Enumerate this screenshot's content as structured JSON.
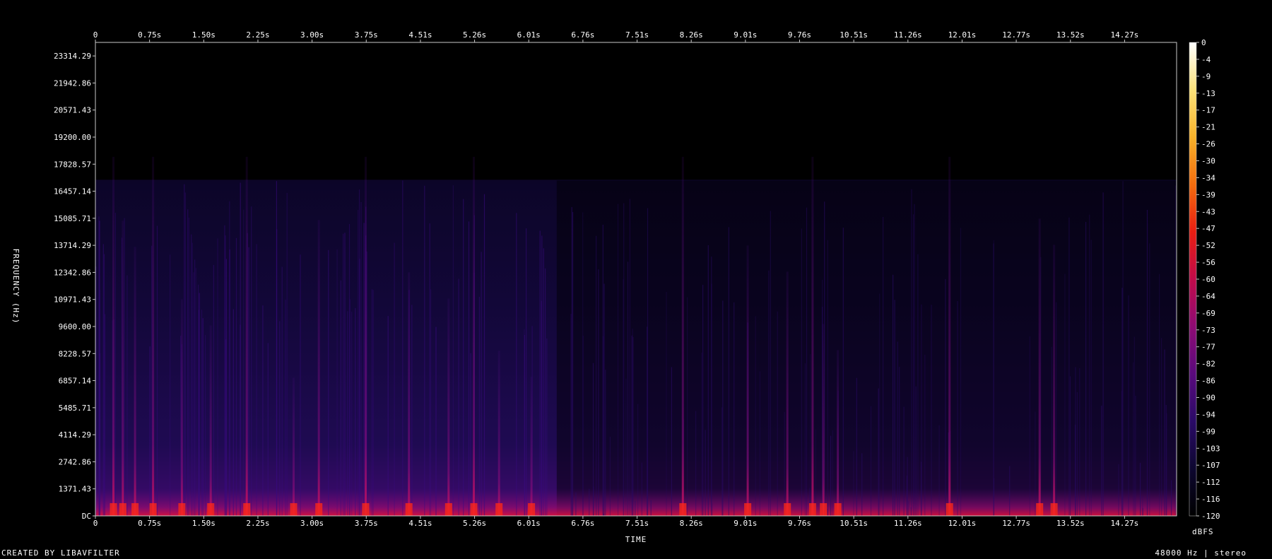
{
  "chart_data": {
    "type": "heatmap",
    "x_axis_label": "TIME",
    "y_axis_label": "FREQUENCY (Hz)",
    "x_ticks": [
      "0",
      "0.75s",
      "1.50s",
      "2.25s",
      "3.00s",
      "3.75s",
      "4.51s",
      "5.26s",
      "6.01s",
      "6.76s",
      "7.51s",
      "8.26s",
      "9.01s",
      "9.76s",
      "10.51s",
      "11.26s",
      "12.01s",
      "12.77s",
      "13.52s",
      "14.27s"
    ],
    "y_ticks": [
      "23314.29",
      "21942.86",
      "20571.43",
      "19200.00",
      "17828.57",
      "16457.14",
      "15085.71",
      "13714.29",
      "12342.86",
      "10971.43",
      "9600.00",
      "8228.57",
      "6857.14",
      "5485.71",
      "4114.29",
      "2742.86",
      "1371.43",
      "DC"
    ],
    "y_range_hz": [
      0,
      24000
    ],
    "x_range_s": [
      0,
      15.0
    ],
    "energy_cutoff_hz": 17000,
    "quiet_segment_s": [
      6.4,
      15.0
    ],
    "colorbar": {
      "unit": "dBFS",
      "ticks": [
        "0",
        "-4",
        "-9",
        "-13",
        "-17",
        "-21",
        "-26",
        "-30",
        "-34",
        "-39",
        "-43",
        "-47",
        "-52",
        "-56",
        "-60",
        "-64",
        "-69",
        "-73",
        "-77",
        "-82",
        "-86",
        "-90",
        "-94",
        "-99",
        "-103",
        "-107",
        "-112",
        "-116",
        "-120"
      ],
      "range": [
        -120,
        0
      ],
      "colors": [
        "#000000",
        "#0d0730",
        "#2a0a66",
        "#5a0a7d",
        "#8e0b74",
        "#c10b4a",
        "#e81e12",
        "#f46d0e",
        "#f8b22a",
        "#fbe27a",
        "#ffffff"
      ]
    },
    "transients_s": [
      0.25,
      0.38,
      0.55,
      0.8,
      1.2,
      1.6,
      2.1,
      2.75,
      3.1,
      3.75,
      4.35,
      4.9,
      5.25,
      5.6,
      6.05,
      8.15,
      9.05,
      9.6,
      9.95,
      10.1,
      10.3,
      11.85,
      13.1,
      13.3
    ]
  },
  "footer": {
    "credit": "CREATED BY LIBAVFILTER",
    "info": "48000 Hz | stereo"
  }
}
